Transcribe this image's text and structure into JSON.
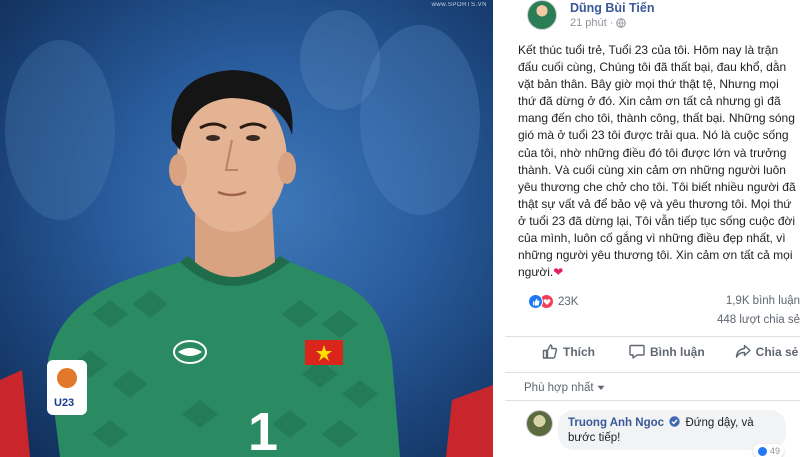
{
  "photo": {
    "watermark": "www.SPORTS.VN",
    "jersey_number": "1",
    "badge_text": "U23"
  },
  "post": {
    "author": "Dũng Bùi Tiến",
    "time": "21 phút",
    "body": "Kết thúc tuổi trẻ, Tuổi 23 của tôi. Hôm nay là trận đấu cuối cùng, Chúng tôi đã thất bại, đau khổ, dằn vặt bản thân. Bây giờ mọi thứ thật tệ, Nhưng mọi thứ đã dừng ở đó. Xin cảm ơn tất cả nhưng gì đã mang đến cho tôi, thành công, thất bại. Những sóng gió mà ở tuổi 23 tôi được trải qua. Nó là cuộc sống của tôi, nhờ những điều đó tôi được lớn và trưởng thành. Và cuối cùng xin cảm ơn những người luôn yêu thương che chở cho tôi. Tôi biết nhiều người đã thật sự vất vả để bảo vệ và yêu thương tôi. Mọi thứ ở tuổi 23 đã dừng lại, Tôi vẫn tiếp tục sống cuộc đời của mình, luôn cố gắng vì những điều đẹp nhất, vì những người yêu thương tôi. Xin cảm ơn tất cả mọi người.",
    "heart": "❤"
  },
  "stats": {
    "reactions": "23K",
    "comments": "1,9K bình luận",
    "shares": "448 lượt chia sẻ"
  },
  "actions": {
    "like": "Thích",
    "comment": "Bình luận",
    "share": "Chia sẻ"
  },
  "sort": {
    "label": "Phù hợp nhất"
  },
  "comment": {
    "name": "Truong Anh Ngoc",
    "text": "Đứng dậy, và bước tiếp!",
    "react_count": "49"
  },
  "colors": {
    "link_blue": "#385898",
    "text_dark": "#1c1e21",
    "text_muted": "#606770",
    "jersey_green": "#2a8a62",
    "sky_blue": "#2a5d9e"
  }
}
